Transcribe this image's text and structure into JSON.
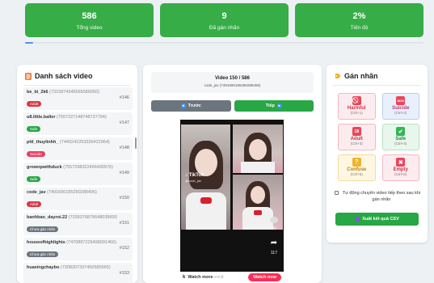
{
  "stats": [
    {
      "value": "586",
      "label": "Tổng video"
    },
    {
      "value": "9",
      "label": "Đã gán nhãn"
    },
    {
      "value": "2%",
      "label": "Tiến độ"
    }
  ],
  "progress": {
    "fraction": 0.02,
    "color": "#5a8df0"
  },
  "video_list": {
    "title": "Danh sách video",
    "icon": "list-icon",
    "items": [
      {
        "user": "be_bi_2k6",
        "id": "(7315874345565586050)",
        "badge": "Adult",
        "badge_color": "#dc3545",
        "index": "#146"
      },
      {
        "user": "u8.little.baller",
        "id": "(7557227148748737794)",
        "badge": "Safe",
        "badge_color": "#28a745",
        "index": "#147"
      },
      {
        "user": "pttl_thuylinhh_",
        "id": "(7440242263336422964)",
        "badge": "Suicide",
        "badge_color": "#e83e5f",
        "index": "#148"
      },
      {
        "user": "grownpwithduck",
        "id": "(7557298322466430976)",
        "badge": "Safe",
        "badge_color": "#28a745",
        "index": "#149"
      },
      {
        "user": "code_jav",
        "id": "(7491690185290288406)",
        "badge": "Adult",
        "badge_color": "#dc3545",
        "index": "#150"
      },
      {
        "user": "banhbao_dayroi.22",
        "id": "(7339376879648039600)",
        "badge": "Chưa gán nhãn",
        "badge_color": "#6c757d",
        "index": "#151"
      },
      {
        "user": "houseofhighlights",
        "id": "(7470887226498091466)",
        "badge": "Chưa gán nhãn",
        "badge_color": "#6c757d",
        "index": "#152"
      },
      {
        "user": "huaxingchaybo",
        "id": "(7308207337450585965)",
        "badge": "",
        "badge_color": "#6c757d",
        "index": "#153"
      }
    ]
  },
  "viewer": {
    "counter": "Video 150 / 586",
    "video_id": "code_jav (7491690185290288406)",
    "prev_label": "Trước",
    "next_label": "Tiếp",
    "tiktok_brand": "TikTok",
    "tiktok_user": "@code_jav",
    "likes": "43",
    "shares": "117",
    "bar_letter": "k",
    "watch_more": "Watch more",
    "watch_more_faded": "excit",
    "watch_now": "Watch now"
  },
  "labels_panel": {
    "title": "Gán nhãn",
    "icon": "tag-icon",
    "buttons": [
      {
        "key": "harmful",
        "name": "Harmful",
        "shortcut": "(Ctrl+1)",
        "icon": "prohibited-icon",
        "glyph": "⃠",
        "icon_color": "#e8475a"
      },
      {
        "key": "suicide",
        "name": "Suicide",
        "shortcut": "(Ctrl+2)",
        "icon": "sos-icon",
        "glyph": "SOS",
        "icon_color": "#e8475a"
      },
      {
        "key": "adult",
        "name": "Adult",
        "shortcut": "(Ctrl+3)",
        "icon": "no-under-18-icon",
        "glyph": "18",
        "icon_color": "#e8475a"
      },
      {
        "key": "safe",
        "name": "Safe",
        "shortcut": "(Ctrl+4)",
        "icon": "check-icon",
        "glyph": "✔",
        "icon_color": "#34b556"
      },
      {
        "key": "confuse",
        "name": "Confuse",
        "shortcut": "(Ctrl+5)",
        "icon": "confused-face-icon",
        "glyph": "?",
        "icon_color": "#f0b429"
      },
      {
        "key": "empty",
        "name": "Empty",
        "shortcut": "(Ctrl+6)",
        "icon": "cross-icon",
        "glyph": "✖",
        "icon_color": "#e8475a"
      }
    ],
    "auto_next_label": "Tự động chuyển video tiếp theo sau khi gán nhãn",
    "export_label": "Xuất kết quả CSV"
  }
}
